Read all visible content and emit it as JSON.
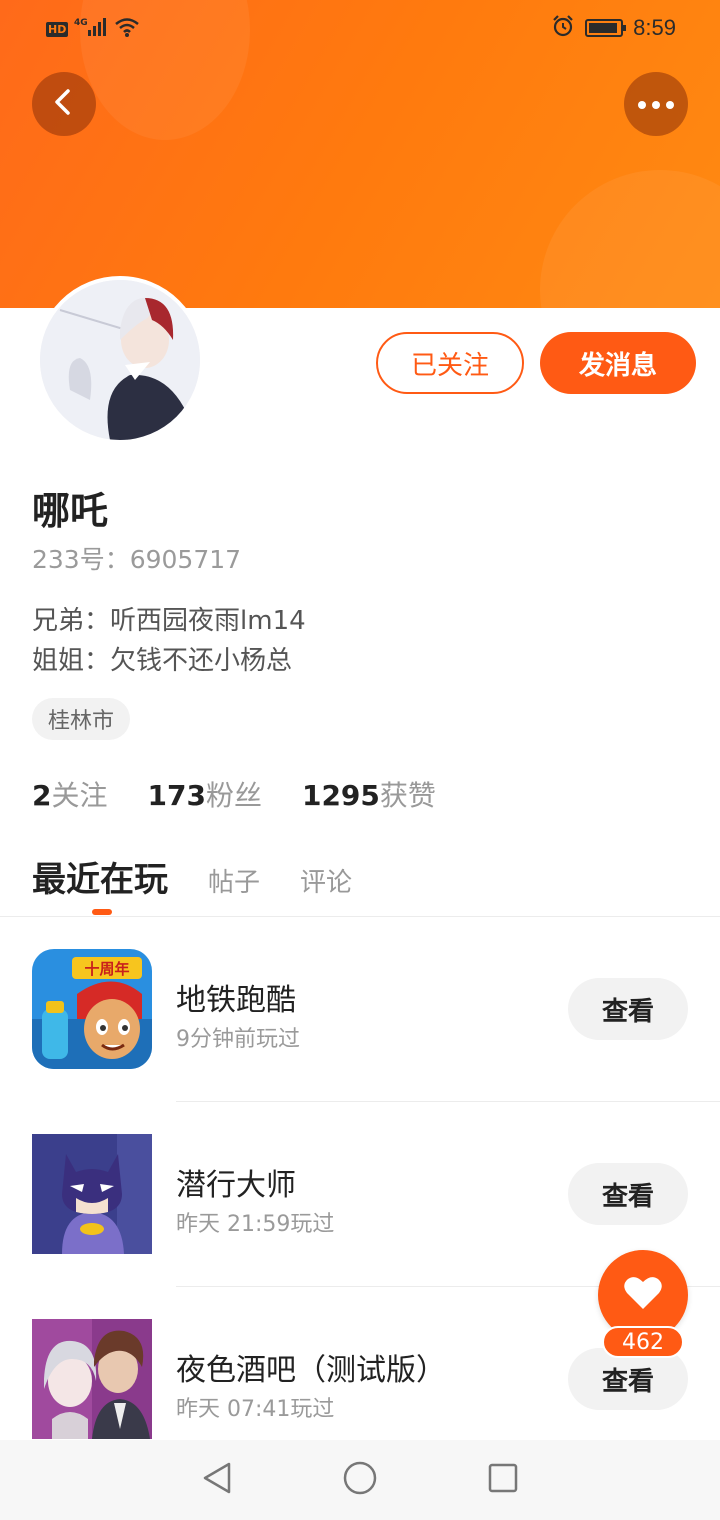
{
  "status_bar": {
    "network_badge": "HD",
    "network_type": "4G",
    "time": "8:59",
    "battery_level": 0.92
  },
  "header": {
    "back_icon": "chevron-left-icon",
    "more_icon": "more-dots-icon"
  },
  "profile": {
    "name": "哪吒",
    "uid_label": "233号：",
    "uid_value": "6905717",
    "relations": [
      {
        "label": "兄弟：",
        "value": "听西园夜雨lm14"
      },
      {
        "label": "姐姐：",
        "value": "欠钱不还小杨总"
      }
    ],
    "city": "桂林市",
    "followed_label": "已关注",
    "message_label": "发消息"
  },
  "stats": [
    {
      "num": "2",
      "label": "关注"
    },
    {
      "num": "173",
      "label": "粉丝"
    },
    {
      "num": "1295",
      "label": "获赞"
    }
  ],
  "tabs": [
    {
      "label": "最近在玩",
      "active": true
    },
    {
      "label": "帖子",
      "active": false
    },
    {
      "label": "评论",
      "active": false
    }
  ],
  "games": [
    {
      "title": "地铁跑酷",
      "played": "9分钟前玩过",
      "button": "查看",
      "icon_text": "十周年"
    },
    {
      "title": "潜行大师",
      "played": "昨天 21:59玩过",
      "button": "查看"
    },
    {
      "title": "夜色酒吧（测试版）",
      "played": "昨天 07:41玩过",
      "button": "查看"
    }
  ],
  "like": {
    "count": "462"
  },
  "colors": {
    "accent": "#ff5a14",
    "banner": "#ff7a10"
  }
}
